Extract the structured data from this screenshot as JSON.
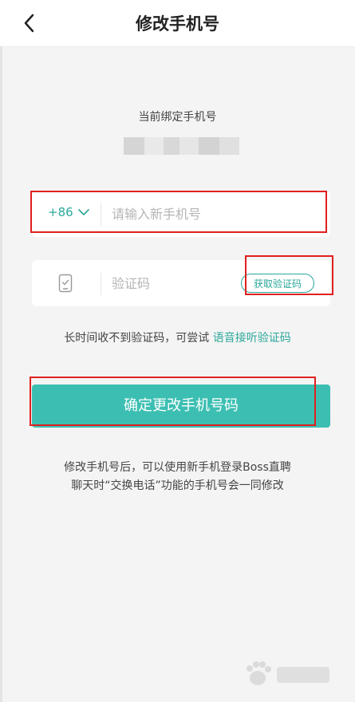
{
  "header": {
    "title": "修改手机号"
  },
  "current": {
    "label": "当前绑定手机号"
  },
  "phone_form": {
    "country_code": "+86",
    "placeholder": "请输入新手机号"
  },
  "code_form": {
    "placeholder": "验证码",
    "get_code_label": "获取验证码"
  },
  "voice": {
    "prefix": "长时间收不到验证码，可尝试",
    "link": "语音接听验证码"
  },
  "confirm_label": "确定更改手机号码",
  "notes": [
    "修改手机号后，可以使用新手机登录Boss直聘",
    "聊天时“交换电话”功能的手机号会一同修改"
  ],
  "colors": {
    "accent": "#2aa89a",
    "button": "#3cbfb2",
    "highlight": "#e0201e"
  },
  "icons": {
    "back": "chevron-left-icon",
    "dropdown": "chevron-down-icon",
    "phone": "phone-check-icon"
  }
}
